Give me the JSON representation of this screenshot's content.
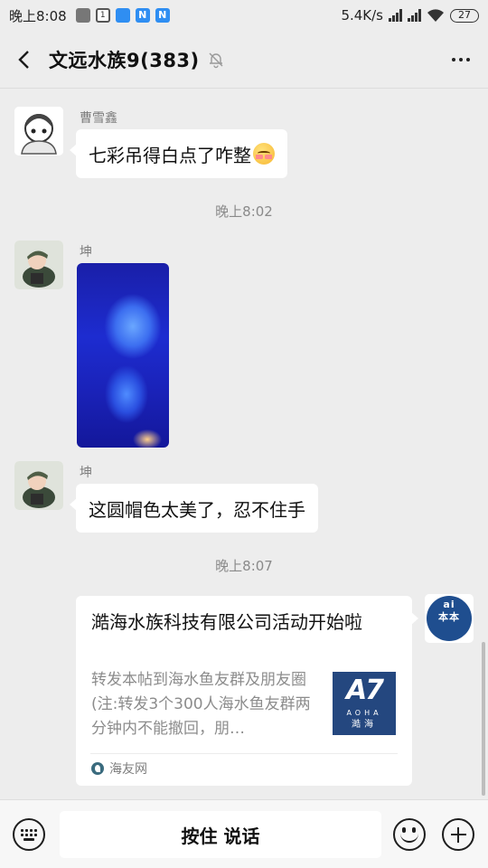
{
  "status_bar": {
    "time": "晚上8:08",
    "app_icons": [
      "gallery-icon",
      "calendar-icon",
      "cloud-icon",
      "n-app-icon",
      "n-app-icon"
    ],
    "calendar_day": "1",
    "n_label": "N",
    "speed": "5.4K/s",
    "signal_label_1": "HD",
    "signal_label_2": "HD",
    "battery": "27"
  },
  "header": {
    "title": "文远水族9(383)",
    "muted": true
  },
  "messages": [
    {
      "type": "text",
      "sender": "曹雪鑫",
      "text": "七彩吊得白点了咋整",
      "emoji": "blush-emoji"
    },
    {
      "type": "timestamp",
      "text": "晚上8:02"
    },
    {
      "type": "image",
      "sender": "坤"
    },
    {
      "type": "text",
      "sender": "坤",
      "text": "这圆帽色太美了，忍不住手"
    },
    {
      "type": "timestamp",
      "text": "晚上8:07"
    },
    {
      "type": "share_card",
      "title": "澔海水族科技有限公司活动开始啦",
      "description": "转发本帖到海水鱼友群及朋友圈(注:转发3个300人海水鱼友群两分钟内不能撤回，朋…",
      "thumb_logo": "A7",
      "thumb_sub": "AOHA",
      "thumb_cn": "澔海",
      "source": "海友网"
    }
  ],
  "sent_avatar": {
    "top": "ai",
    "bottom": "本本"
  },
  "bottom_bar": {
    "voice_label": "按住 说话"
  },
  "colors": {
    "background": "#ededed",
    "bubble": "#ffffff",
    "timestamp_text": "#8a8a8a",
    "sender_text": "#7d7d7d",
    "card_thumb": "#24477f"
  }
}
